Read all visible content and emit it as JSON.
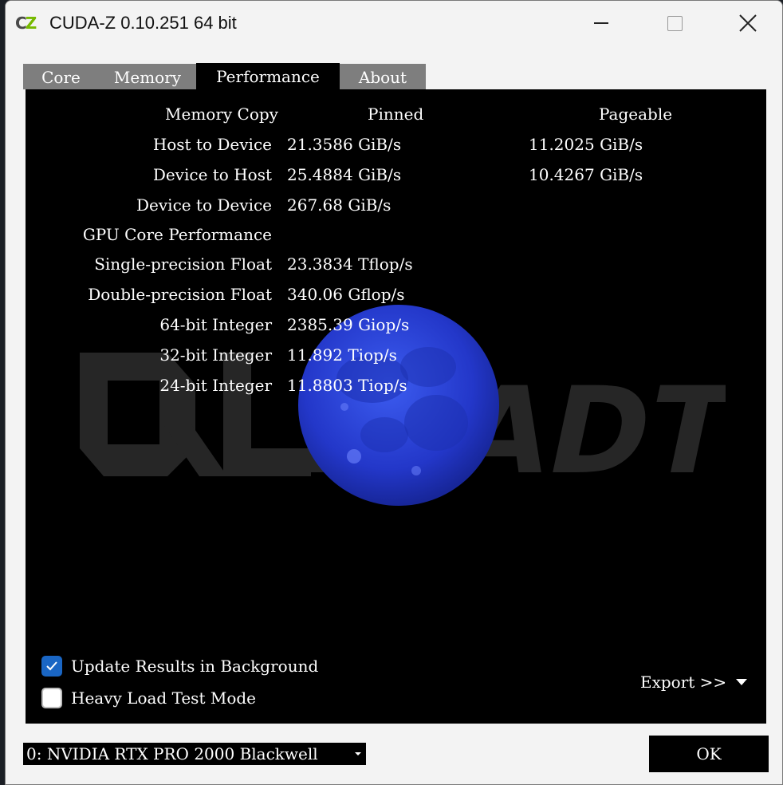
{
  "window": {
    "title": "CUDA-Z 0.10.251 64 bit",
    "app_icon": {
      "text_c": "C",
      "text_z": "Z"
    }
  },
  "tabs": [
    {
      "label": "Core"
    },
    {
      "label": "Memory"
    },
    {
      "label": "Performance"
    },
    {
      "label": "About"
    }
  ],
  "performance": {
    "headers": {
      "label": "Memory Copy",
      "pinned": "Pinned",
      "pageable": "Pageable"
    },
    "rows": [
      {
        "label": "Host to Device",
        "pinned": "21.3586 GiB/s",
        "pageable": "11.2025 GiB/s"
      },
      {
        "label": "Device to Host",
        "pinned": "25.4884 GiB/s",
        "pageable": "10.4267 GiB/s"
      },
      {
        "label": "Device to Device",
        "pinned": "267.68 GiB/s",
        "pageable": ""
      },
      {
        "label": "GPU Core Performance",
        "pinned": "",
        "pageable": ""
      },
      {
        "label": "Single-precision Float",
        "pinned": "23.3834 Tflop/s",
        "pageable": ""
      },
      {
        "label": "Double-precision Float",
        "pinned": "340.06 Gflop/s",
        "pageable": ""
      },
      {
        "label": "64-bit Integer",
        "pinned": "2385.39 Giop/s",
        "pageable": ""
      },
      {
        "label": "32-bit Integer",
        "pinned": "11.892 Tiop/s",
        "pageable": ""
      },
      {
        "label": "24-bit Integer",
        "pinned": "11.8803 Tiop/s",
        "pageable": ""
      }
    ]
  },
  "options": {
    "update_background": {
      "label": "Update Results in Background",
      "checked": true
    },
    "heavy_load": {
      "label": "Heavy Load Test Mode",
      "checked": false
    }
  },
  "export": {
    "label": "Export >>"
  },
  "device": {
    "selected": "0: NVIDIA RTX PRO 2000 Blackwell"
  },
  "ok_button": {
    "label": "OK"
  },
  "watermark": {
    "text": "LEADTEK"
  },
  "colors": {
    "accent": "#1a66c4",
    "moon": "#2a44d8",
    "panel": "#000000",
    "tab_inactive": "#7e7e7e"
  }
}
